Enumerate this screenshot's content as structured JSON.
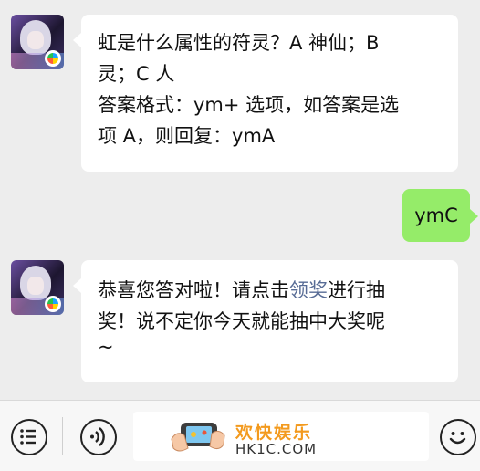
{
  "messages": {
    "question": {
      "line1": "虹是什么属性的符灵？A 神仙；B",
      "line2": "灵；C 人",
      "line3": "答案格式：ym+ 选项，如答案是选",
      "line4": "项 A，则回复：ymA"
    },
    "reply": "ymC",
    "response": {
      "line1_pre": "恭喜您答对啦！请点击",
      "line1_link": "领奖",
      "line1_post": "进行抽",
      "line2": "奖！说不定你今天就能抽中大奖呢",
      "line3": "~"
    }
  },
  "toolbar": {
    "brand_cn": "欢快娱乐",
    "brand_en": "HK1C.COM"
  },
  "icons": {
    "menu": "list-icon",
    "voice": "sound-icon",
    "emoji": "smile-icon"
  },
  "colors": {
    "background": "#ededed",
    "bubble": "#ffffff",
    "self_bubble": "#95ec69",
    "link": "#576b95",
    "brand": "#f39a1e"
  }
}
